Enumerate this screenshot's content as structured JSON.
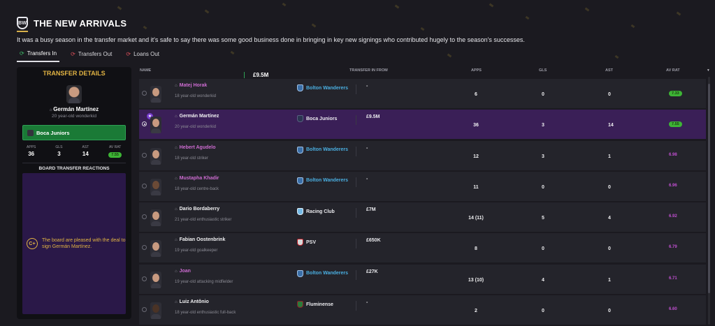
{
  "header": {
    "title": "THE NEW ARRIVALS",
    "crest_text": "BW",
    "intro": "It was a busy season in the transfer market and it's safe to say there was some good business done in bringing in key new signings who contributed hugely to the season's successes."
  },
  "tabs": [
    {
      "label": "Transfers In",
      "icon": "transfer-in-icon"
    },
    {
      "label": "Transfers Out",
      "icon": "transfer-out-icon"
    },
    {
      "label": "Loans Out",
      "icon": "loan-out-icon"
    }
  ],
  "details": {
    "title": "TRANSFER DETAILS",
    "name": "Germán Martínez",
    "desc": "20 year-old wonderkid",
    "club": "Boca Juniors",
    "fee": "£9.5M",
    "stat_labels": {
      "apps": "APPS",
      "gls": "GLS",
      "ast": "AST",
      "av": "AV RAT"
    },
    "stats": {
      "apps": "36",
      "gls": "3",
      "ast": "14",
      "av": "7.55"
    },
    "reactions_title": "BOARD TRANSFER REACTIONS",
    "grade": "C+",
    "message": "The board are pleased with the deal to sign Germán Martínez."
  },
  "columns": {
    "name": "NAME",
    "from": "TRANSFER IN FROM",
    "apps": "APPS",
    "gls": "GLS",
    "ast": "AST",
    "av": "AV RAT"
  },
  "rows": [
    {
      "name": "Matej Horak",
      "desc": "18 year-old wonderkid",
      "club": "Bolton Wanderers",
      "fee": "-",
      "apps": "6",
      "gls": "0",
      "ast": "0",
      "av": "7.33"
    },
    {
      "name": "Germán Martínez",
      "desc": "20 year-old wonderkid",
      "club": "Boca Juniors",
      "fee": "£9.5M",
      "apps": "36",
      "gls": "3",
      "ast": "14",
      "av": "7.55"
    },
    {
      "name": "Hebert Agudelo",
      "desc": "18 year-old striker",
      "club": "Bolton Wanderers",
      "fee": "-",
      "apps": "12",
      "gls": "3",
      "ast": "1",
      "av": "6.98"
    },
    {
      "name": "Mustapha Khadir",
      "desc": "18 year-old centre-back",
      "club": "Bolton Wanderers",
      "fee": "-",
      "apps": "11",
      "gls": "0",
      "ast": "0",
      "av": "6.96"
    },
    {
      "name": "Dario Bordaberry",
      "desc": "21 year-old enthusiastic striker",
      "club": "Racing Club",
      "fee": "£7M",
      "apps": "14 (11)",
      "gls": "5",
      "ast": "4",
      "av": "6.92"
    },
    {
      "name": "Fabian Oostenbrink",
      "desc": "19 year-old goalkeeper",
      "club": "PSV",
      "fee": "£650K",
      "apps": "8",
      "gls": "0",
      "ast": "0",
      "av": "6.79"
    },
    {
      "name": "Joan",
      "desc": "19 year-old attacking midfielder",
      "club": "Bolton Wanderers",
      "fee": "£27K",
      "apps": "13 (10)",
      "gls": "4",
      "ast": "1",
      "av": "6.71"
    },
    {
      "name": "Luiz Antônio",
      "desc": "18 year-old enthusiastic full-back",
      "club": "Fluminense",
      "fee": "-",
      "apps": "2",
      "gls": "0",
      "ast": "0",
      "av": "6.60"
    }
  ]
}
